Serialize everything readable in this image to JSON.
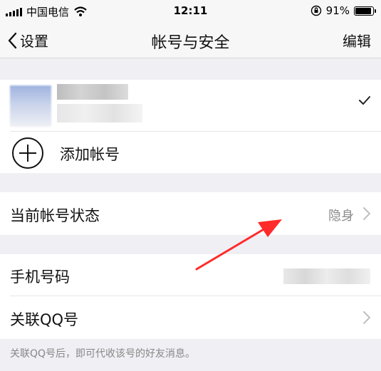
{
  "status_bar": {
    "carrier": "中国电信",
    "time": "12:11",
    "battery_percent": "91%",
    "battery_level": 0.91
  },
  "nav": {
    "back_label": "设置",
    "title": "帐号与安全",
    "edit_label": "编辑"
  },
  "accounts": {
    "add_account_label": "添加帐号"
  },
  "account_status": {
    "label": "当前帐号状态",
    "value": "隐身"
  },
  "phone": {
    "label": "手机号码"
  },
  "qq": {
    "label": "关联QQ号",
    "footnote": "关联QQ号后，即可代收该号的好友消息。"
  },
  "colors": {
    "background": "#efeff4",
    "annotation_arrow": "#ff2a2a"
  }
}
